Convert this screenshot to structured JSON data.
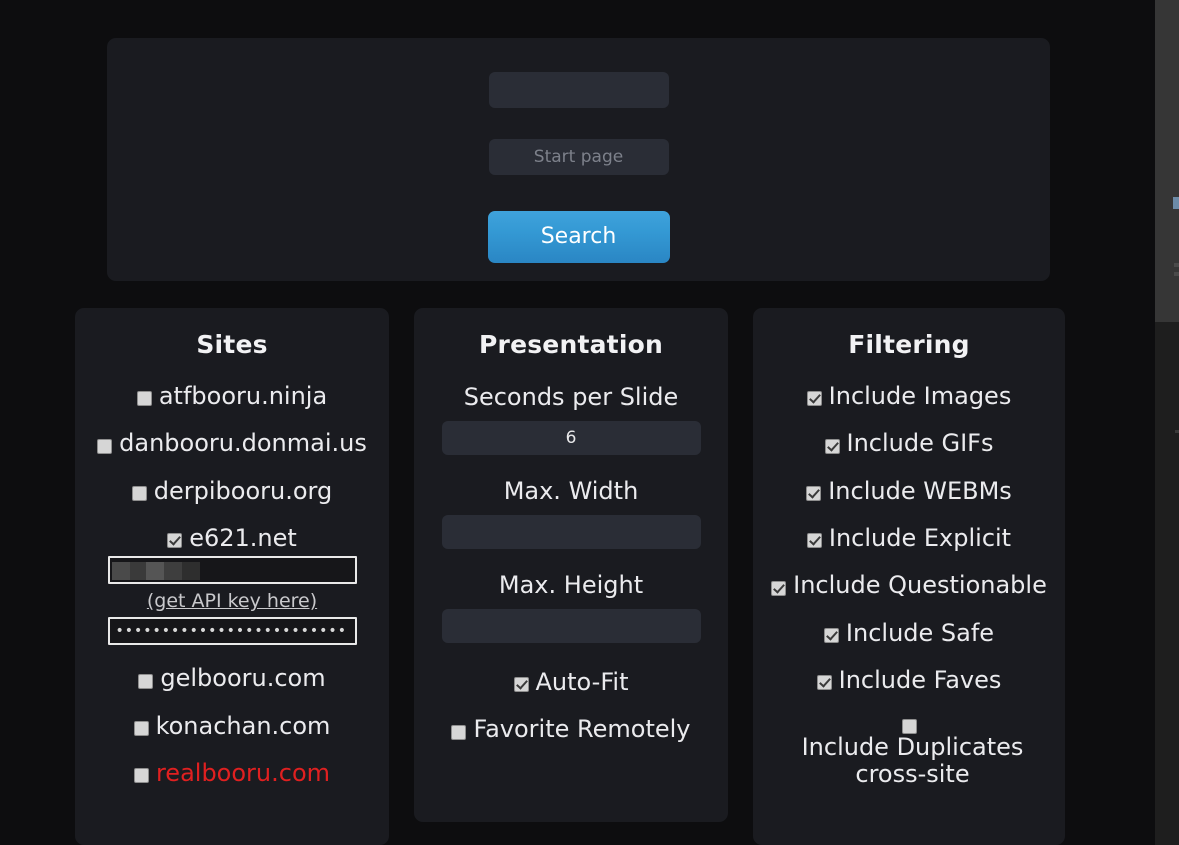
{
  "colors": {
    "page_background": "#0d0d0f",
    "card_background": "#1a1b20",
    "input_background": "#2a2d36",
    "accent_button": "#3499d4",
    "text_primary": "#ebebee",
    "link_red": "#e02020",
    "checkbox_fill": "#d6d6d6"
  },
  "search_panel": {
    "tags_input": {
      "value": "",
      "placeholder": ""
    },
    "start_page_input": {
      "value": "",
      "placeholder": "Start page"
    },
    "search_button_label": "Search"
  },
  "sites": {
    "title": "Sites",
    "items": [
      {
        "label": "atfbooru.ninja",
        "checked": false,
        "red": false
      },
      {
        "label": "danbooru.donmai.us",
        "checked": false,
        "red": false
      },
      {
        "label": "derpibooru.org",
        "checked": false,
        "red": false
      },
      {
        "label": "e621.net",
        "checked": true,
        "red": false
      }
    ],
    "credentials": {
      "username_input": {
        "value": "",
        "placeholder": "",
        "redacted": true
      },
      "api_key_link": "(get API key here)",
      "password_input": {
        "value": "••••••••••••••••••••••••••••••",
        "placeholder": ""
      }
    },
    "items_after": [
      {
        "label": "gelbooru.com",
        "checked": false,
        "red": false
      },
      {
        "label": "konachan.com",
        "checked": false,
        "red": false
      },
      {
        "label": "realbooru.com",
        "checked": false,
        "red": true
      }
    ]
  },
  "presentation": {
    "title": "Presentation",
    "seconds_per_slide": {
      "label": "Seconds per Slide",
      "value": "6",
      "placeholder": ""
    },
    "max_width": {
      "label": "Max. Width",
      "value": "",
      "placeholder": ""
    },
    "max_height": {
      "label": "Max. Height",
      "value": "",
      "placeholder": ""
    },
    "checkboxes": [
      {
        "label": "Auto-Fit",
        "checked": true
      },
      {
        "label": "Favorite Remotely",
        "checked": false
      }
    ]
  },
  "filtering": {
    "title": "Filtering",
    "items": [
      {
        "label": "Include Images",
        "checked": true
      },
      {
        "label": "Include GIFs",
        "checked": true
      },
      {
        "label": "Include WEBMs",
        "checked": true
      },
      {
        "label": "Include Explicit",
        "checked": true
      },
      {
        "label": "Include Questionable",
        "checked": true
      },
      {
        "label": "Include Safe",
        "checked": true
      },
      {
        "label": "Include Faves",
        "checked": true
      },
      {
        "label": "Include Duplicates cross-site",
        "checked": false
      }
    ]
  }
}
